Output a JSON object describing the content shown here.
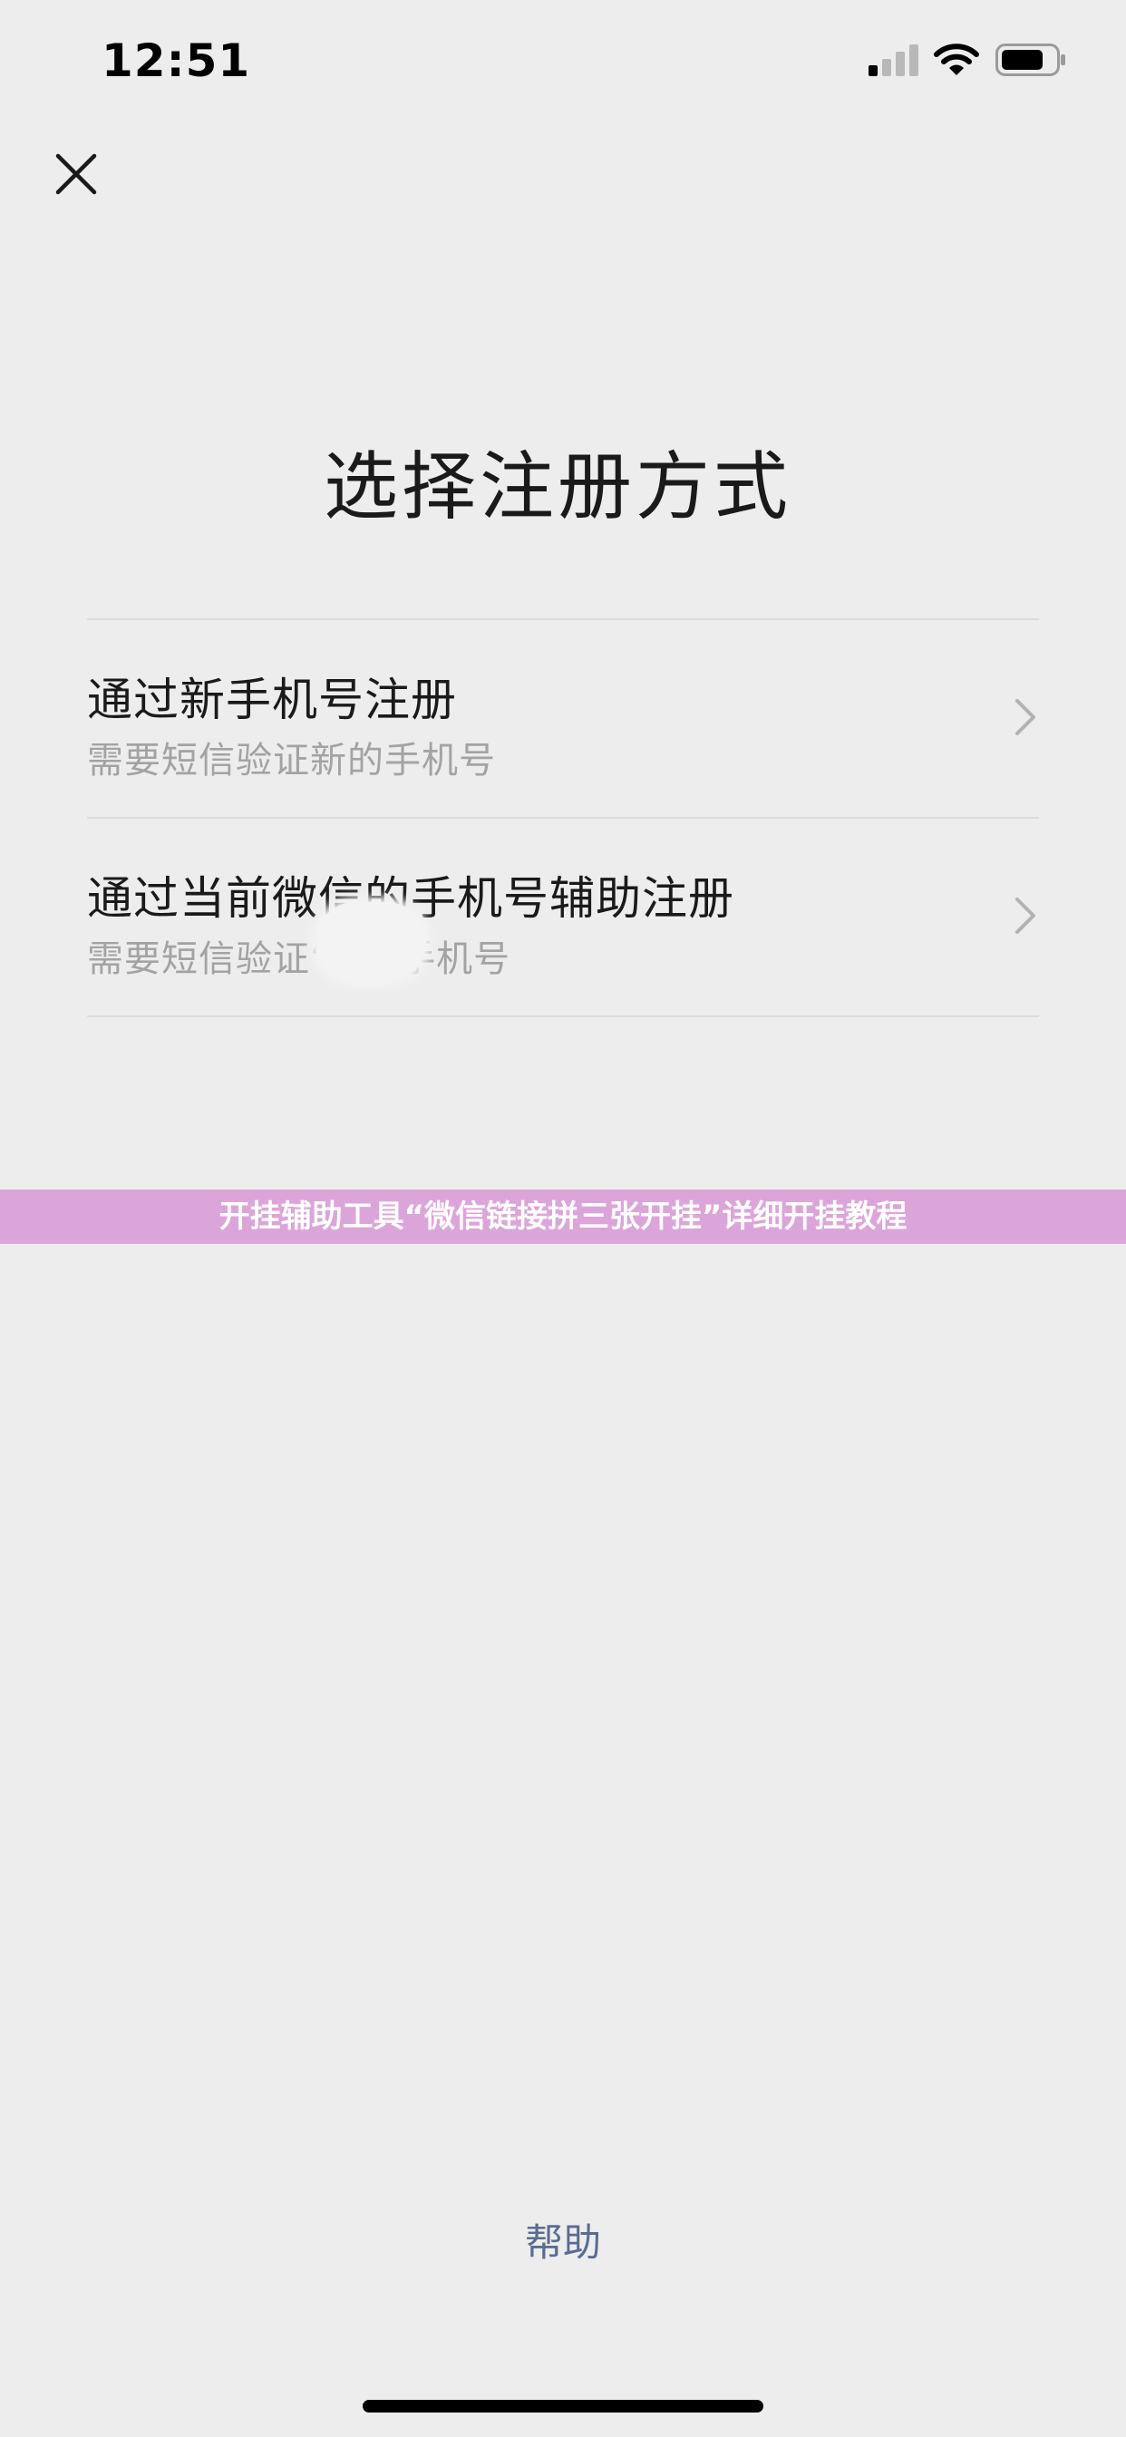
{
  "status_bar": {
    "time": "12:51",
    "icons": [
      "signal-icon",
      "wifi-icon",
      "battery-icon"
    ]
  },
  "nav": {
    "close_icon": "close-icon"
  },
  "page": {
    "title": "选择注册方式"
  },
  "options": [
    {
      "title": "通过新手机号注册",
      "subtitle": "需要短信验证新的手机号",
      "icon": "chevron-right-icon"
    },
    {
      "title": "通过当前微信的手机号辅助注册",
      "subtitle": "需要短信验证“     ”的手机号",
      "icon": "chevron-right-icon"
    }
  ],
  "banner": {
    "text": "开挂辅助工具“微信链接拼三张开挂”详细开挂教程",
    "color": "#dca5da"
  },
  "footer": {
    "help": "帮助"
  },
  "colors": {
    "background": "#ededed",
    "link": "#5a6c91",
    "subtitle": "#a3a3a3"
  }
}
